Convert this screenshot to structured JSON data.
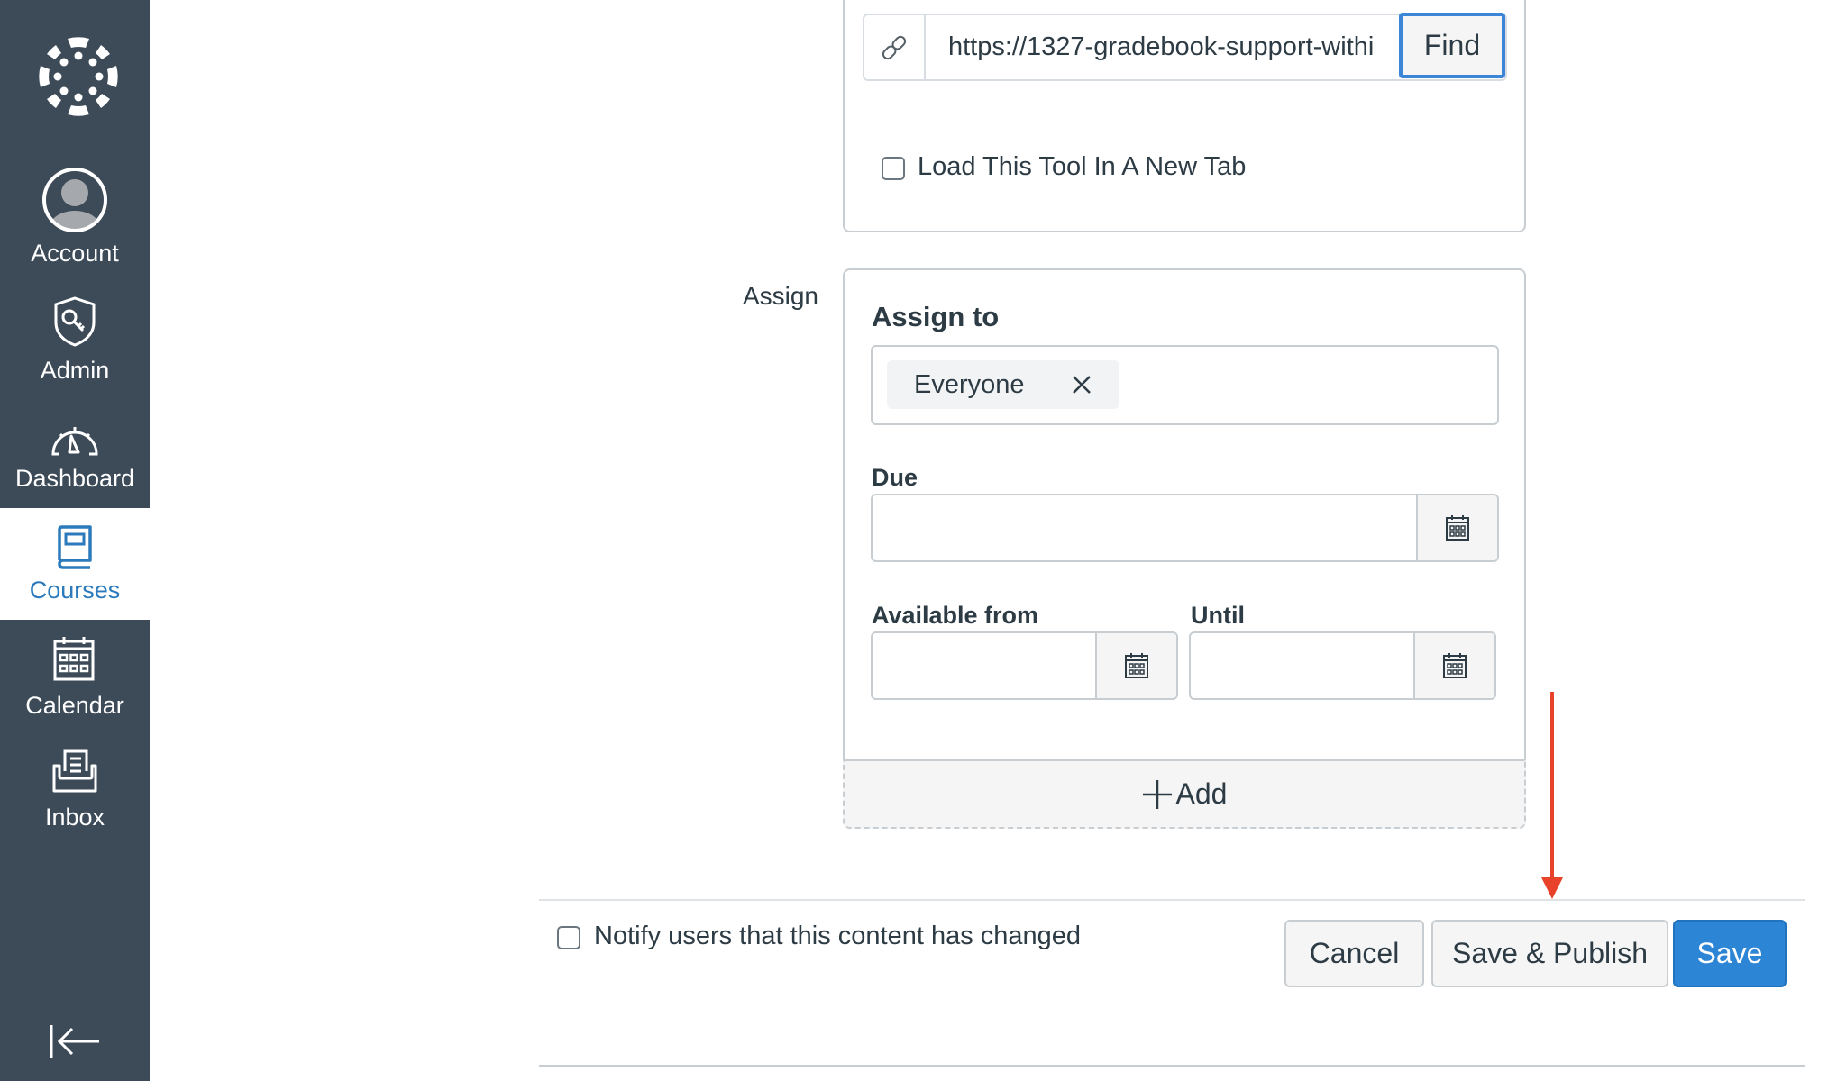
{
  "sidebar": {
    "items": [
      {
        "label": "Account",
        "icon": "avatar-icon",
        "active": false
      },
      {
        "label": "Admin",
        "icon": "shield-key-icon",
        "active": false
      },
      {
        "label": "Dashboard",
        "icon": "speedometer-icon",
        "active": false
      },
      {
        "label": "Courses",
        "icon": "book-icon",
        "active": true
      },
      {
        "label": "Calendar",
        "icon": "calendar-icon",
        "active": false
      },
      {
        "label": "Inbox",
        "icon": "inbox-icon",
        "active": false
      }
    ],
    "logo": "canvas-logo-icon",
    "collapse_icon": "collapse-left-icon"
  },
  "colors": {
    "sidebar_bg": "#3d4b59",
    "active_nav": "#2b7abc",
    "primary_button": "#2d85d6",
    "annotation_arrow": "#e8432a"
  },
  "external_tool": {
    "url_value": "https://1327-gradebook-support-withi",
    "find_label": "Find",
    "new_tab_label": "Load This Tool In A New Tab",
    "new_tab_checked": false
  },
  "assign": {
    "section_label": "Assign",
    "assign_to_label": "Assign to",
    "assignees": [
      {
        "label": "Everyone"
      }
    ],
    "due_label": "Due",
    "due_value": "",
    "available_from_label": "Available from",
    "available_from_value": "",
    "until_label": "Until",
    "until_value": "",
    "add_label": "Add"
  },
  "footer": {
    "notify_label": "Notify users that this content has changed",
    "notify_checked": false,
    "cancel_label": "Cancel",
    "save_publish_label": "Save & Publish",
    "save_label": "Save"
  }
}
